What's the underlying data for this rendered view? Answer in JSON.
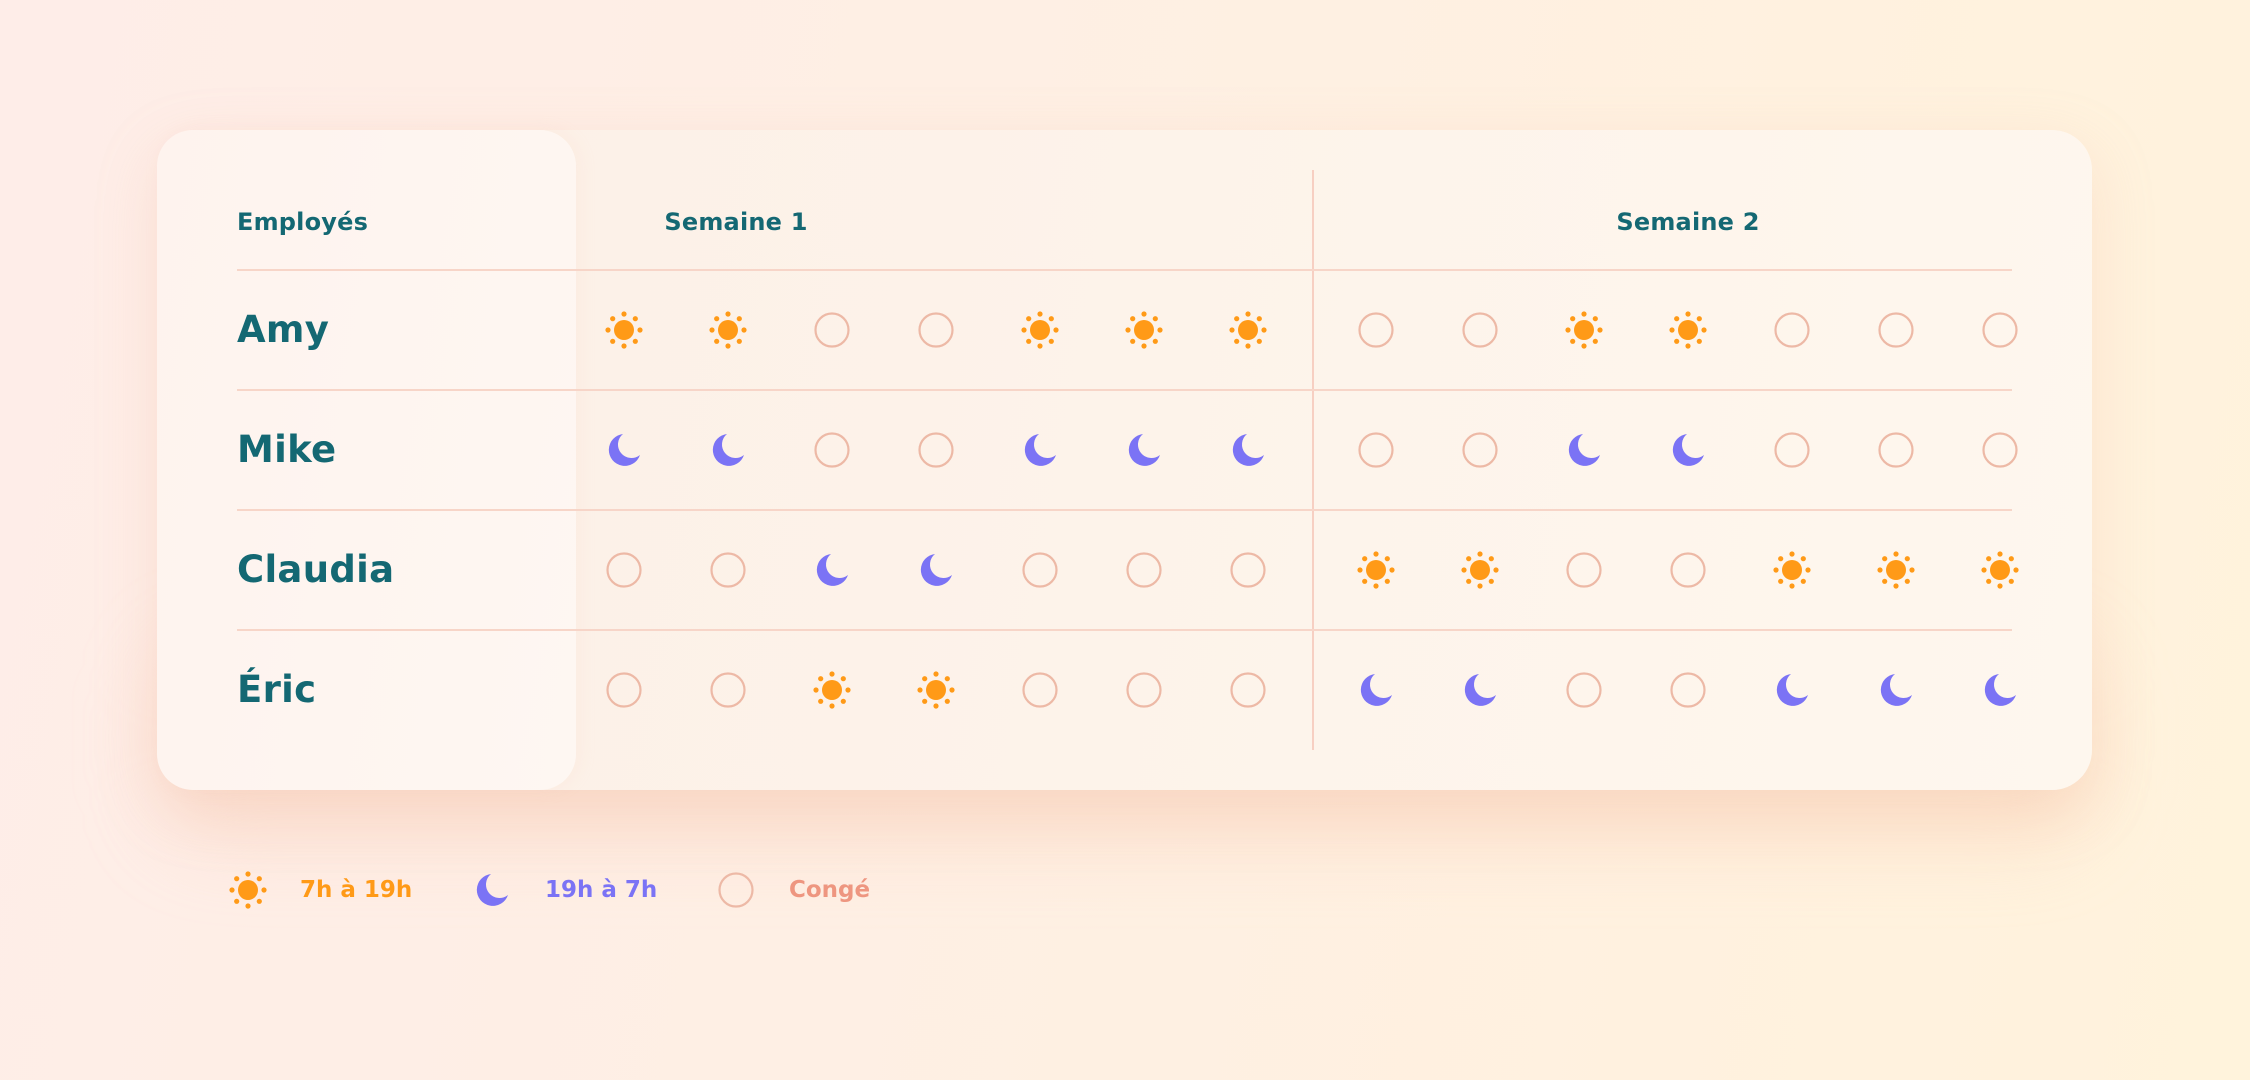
{
  "headers": {
    "employees": "Employés",
    "weeks": [
      "Semaine 1",
      "Semaine 2"
    ]
  },
  "shift_types": {
    "day": {
      "icon": "sun-icon",
      "label": "7h à 19h",
      "color": "#FF9A17"
    },
    "night": {
      "icon": "moon-icon",
      "label": "19h à 7h",
      "color": "#7B73F5"
    },
    "off": {
      "icon": "empty-circle-icon",
      "label": "Congé",
      "color": "#EDB9A6",
      "label_color": "#EE9680"
    }
  },
  "employees": [
    {
      "name": "Amy",
      "week1": [
        "day",
        "day",
        "off",
        "off",
        "day",
        "day",
        "day"
      ],
      "week2": [
        "off",
        "off",
        "day",
        "day",
        "off",
        "off",
        "off"
      ]
    },
    {
      "name": "Mike",
      "week1": [
        "night",
        "night",
        "off",
        "off",
        "night",
        "night",
        "night"
      ],
      "week2": [
        "off",
        "off",
        "night",
        "night",
        "off",
        "off",
        "off"
      ]
    },
    {
      "name": "Claudia",
      "week1": [
        "off",
        "off",
        "night",
        "night",
        "off",
        "off",
        "off"
      ],
      "week2": [
        "day",
        "day",
        "off",
        "off",
        "day",
        "day",
        "day"
      ]
    },
    {
      "name": "Éric",
      "week1": [
        "off",
        "off",
        "day",
        "day",
        "off",
        "off",
        "off"
      ],
      "week2": [
        "night",
        "night",
        "off",
        "off",
        "night",
        "night",
        "night"
      ]
    }
  ],
  "legend": [
    {
      "type": "day",
      "label": "7h à 19h"
    },
    {
      "type": "night",
      "label": "19h à 7h"
    },
    {
      "type": "off",
      "label": "Congé"
    }
  ],
  "colors": {
    "text_primary": "#146873",
    "divider": "#F7D5C8"
  }
}
